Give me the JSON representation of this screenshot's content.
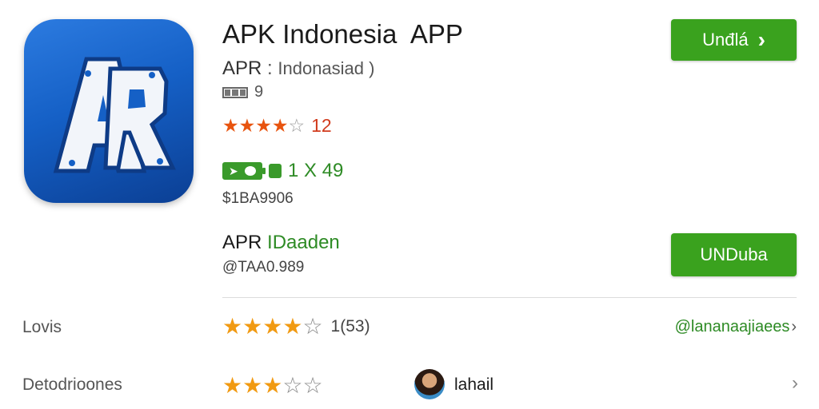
{
  "app": {
    "title": "APK Indonesia  APP",
    "subtitle_prefix": "APR",
    "subtitle_sep": ":",
    "developer": "Indonasiad  )",
    "size_value": "9",
    "rating_value": "12",
    "battery_text": "1 X 49",
    "price": "$1BA9906",
    "install_button": "Unđlá",
    "install_chevron": "›",
    "icon_name": "app-logo-ar"
  },
  "section2": {
    "title_prefix": "APR",
    "title_green": "IDaaden",
    "subtitle": "@TAA0.989",
    "button": "UNDuba"
  },
  "rows": [
    {
      "label": "Lovis",
      "stars_full": 4,
      "stars_empty": 1,
      "count": "1(53)",
      "link": "@lananaajiaees",
      "link_chevron": "›"
    },
    {
      "label": "Detodrioones",
      "stars_full": 3,
      "stars_empty": 2,
      "user": "lahail",
      "chevron": "›"
    }
  ],
  "colors": {
    "accent_green": "#3aa21e",
    "star_orange": "#f19a12",
    "rating_red": "#d13b1d",
    "icon_blue": "#1560c6"
  }
}
